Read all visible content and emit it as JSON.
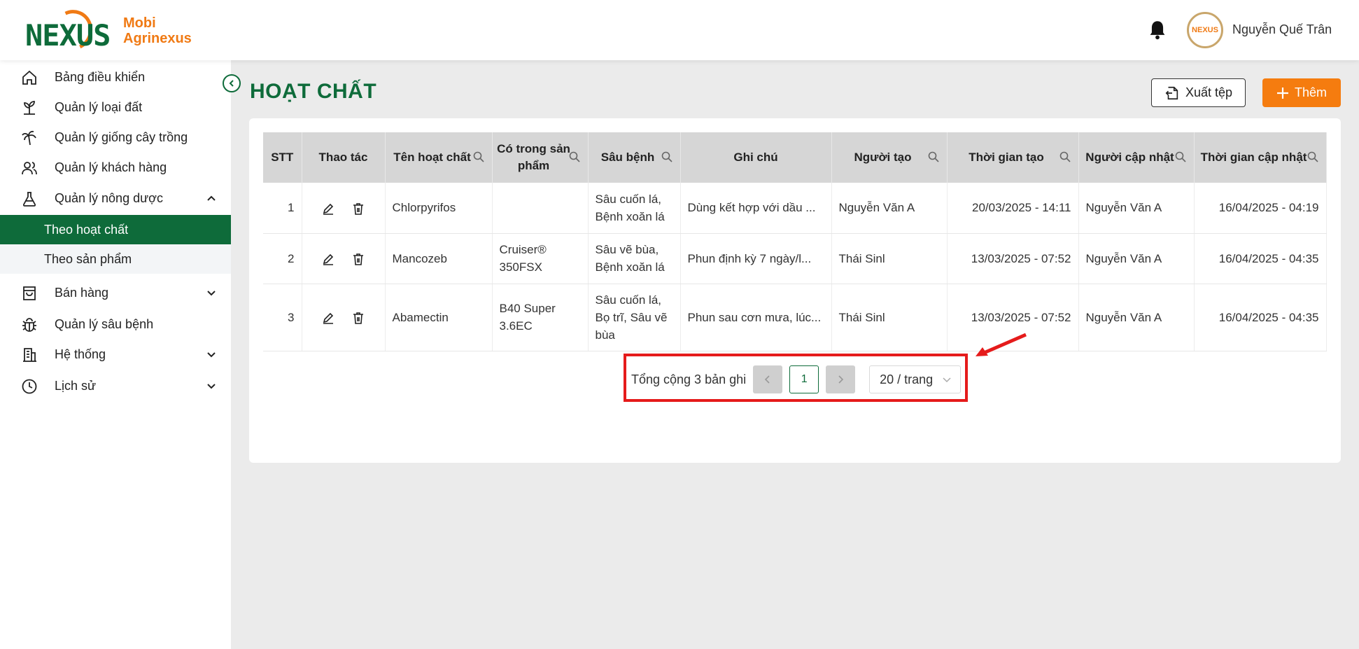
{
  "app": {
    "logo_word": "NEXUS",
    "brand_line1": "Mobi",
    "brand_line2": "Agrinexus"
  },
  "user": {
    "name": "Nguyễn Quế Trân",
    "avatar_text": "NEXUS"
  },
  "sidebar": {
    "items": [
      {
        "label": "Bảng điều khiển",
        "icon": "home-icon"
      },
      {
        "label": "Quản lý loại đất",
        "icon": "sprout-icon"
      },
      {
        "label": "Quản lý giống cây trồng",
        "icon": "palm-icon"
      },
      {
        "label": "Quản lý khách hàng",
        "icon": "users-icon"
      },
      {
        "label": "Quản lý nông dược",
        "icon": "flask-icon"
      },
      {
        "label": "Bán hàng",
        "icon": "bag-icon"
      },
      {
        "label": "Quản lý sâu bệnh",
        "icon": "bug-icon"
      },
      {
        "label": "Hệ thống",
        "icon": "building-icon"
      },
      {
        "label": "Lịch sử",
        "icon": "clock-icon"
      }
    ],
    "sub_items": [
      {
        "label": "Theo hoạt chất",
        "active": true
      },
      {
        "label": "Theo sản phẩm",
        "active": false
      }
    ]
  },
  "page": {
    "title": "HOẠT CHẤT",
    "export_label": "Xuất tệp",
    "add_label": "Thêm"
  },
  "table": {
    "headers": [
      "STT",
      "Thao tác",
      "Tên hoạt chất",
      "Có trong sản phẩm",
      "Sâu bệnh",
      "Ghi chú",
      "Người tạo",
      "Thời gian tạo",
      "Người cập nhật",
      "Thời gian cập nhật"
    ],
    "rows": [
      {
        "stt": "1",
        "name": "Chlorpyrifos",
        "product": "",
        "pest": "Sâu cuốn lá, Bệnh xoăn lá",
        "note": "Dùng kết hợp với dầu ...",
        "creator": "Nguyễn Văn A",
        "created": "20/03/2025 - 14:11",
        "updater": "Nguyễn Văn A",
        "updated": "16/04/2025 - 04:19"
      },
      {
        "stt": "2",
        "name": "Mancozeb",
        "product": "Cruiser® 350FSX",
        "pest": "Sâu vẽ bùa, Bệnh xoăn lá",
        "note": "Phun định kỳ 7 ngày/l...",
        "creator": "Thái Sinl",
        "created": "13/03/2025 - 07:52",
        "updater": "Nguyễn Văn A",
        "updated": "16/04/2025 - 04:35"
      },
      {
        "stt": "3",
        "name": "Abamectin",
        "product": "B40 Super 3.6EC",
        "pest": "Sâu cuốn lá, Bọ trĩ, Sâu vẽ bùa",
        "note": "Phun sau cơn mưa, lúc...",
        "creator": "Thái Sinl",
        "created": "13/03/2025 - 07:52",
        "updater": "Nguyễn Văn A",
        "updated": "16/04/2025 - 04:35"
      }
    ]
  },
  "pagination": {
    "total_text": "Tổng cộng 3 bản ghi",
    "current_page": "1",
    "page_size": "20 / trang"
  },
  "colors": {
    "primary": "#0e6b3a",
    "accent": "#f57c0f",
    "highlight": "#e51b1b"
  }
}
